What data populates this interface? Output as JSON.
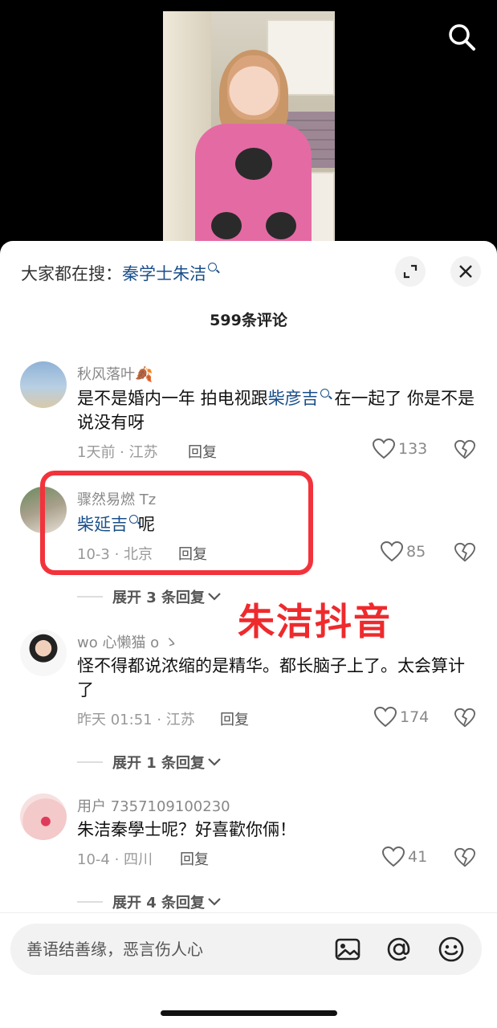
{
  "header": {
    "search_prefix": "大家都在搜：",
    "search_term": "秦学士朱洁",
    "comment_count_title": "599条评论"
  },
  "comments": [
    {
      "username": "秋风落叶🍂",
      "content_parts": [
        "是不是婚内一年 拍电视跟",
        "柴彦吉",
        " 在一起了 你是不是说没有呀"
      ],
      "meta": "1天前 · 江苏",
      "reply_label": "回复",
      "likes": "133"
    },
    {
      "username": "骤然易燃 Tz",
      "content_parts": [
        "柴延吉",
        "呢"
      ],
      "meta": "10-3 · 北京",
      "reply_label": "回复",
      "likes": "85",
      "expand_label": "展开 3 条回复"
    },
    {
      "username": "wo 心懒猫 o ゝ",
      "content": "怪不得都说浓缩的是精华。都长脑子上了。太会算计了",
      "meta": "昨天 01:51 · 江苏",
      "reply_label": "回复",
      "likes": "174",
      "expand_label": "展开 1 条回复"
    },
    {
      "username": "用户 7357109100230",
      "content": "朱洁秦學士呢？好喜歡你倆！",
      "meta": "10-4 · 四川",
      "reply_label": "回复",
      "likes": "41",
      "expand_label": "展开 4 条回复"
    }
  ],
  "overlay_text": "朱洁抖音",
  "input": {
    "placeholder": "善语结善缘，恶言伤人心"
  },
  "icons": {
    "top": "search-icon",
    "header": [
      "expand-icon",
      "close-icon"
    ],
    "bar": [
      "image-icon",
      "at-icon",
      "emoji-icon"
    ]
  },
  "colors": {
    "link": "#1a4f8a",
    "highlight": "#ee2a2d"
  }
}
